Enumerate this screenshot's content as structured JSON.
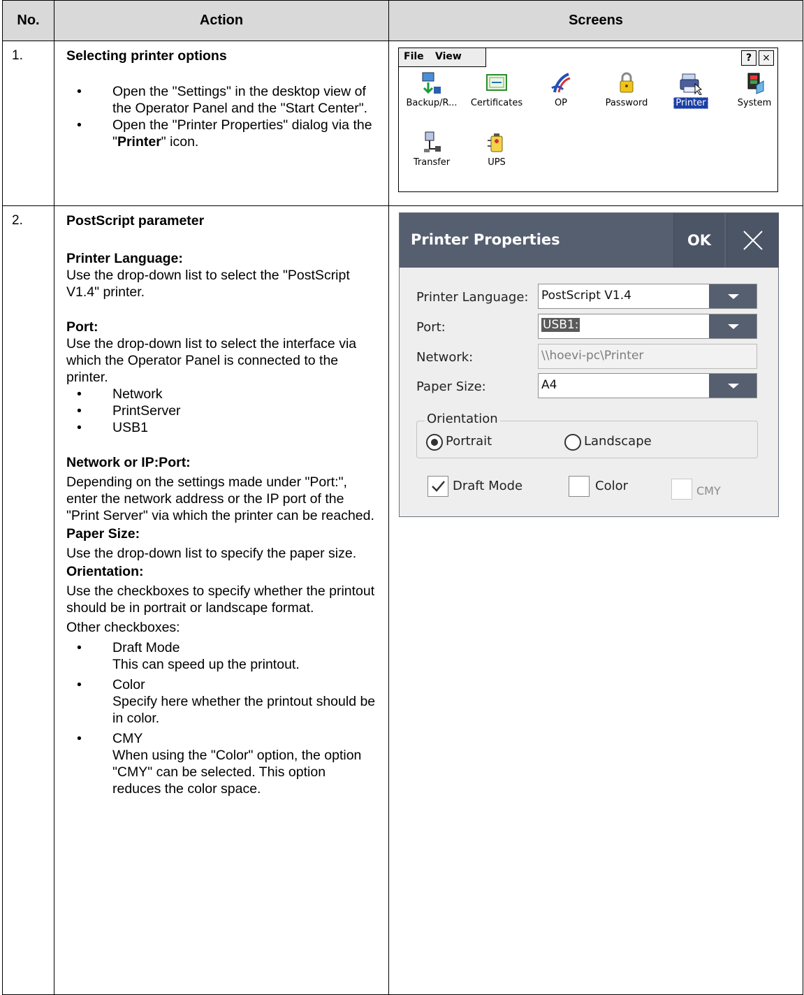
{
  "table": {
    "headers": {
      "no": "No.",
      "action": "Action",
      "screens": "Screens"
    }
  },
  "row1": {
    "number": "1.",
    "title": "Selecting printer options",
    "bullets": [
      "Open the \"Settings\" in the desktop view of the Operator Panel and the \"Start Center\".",
      {
        "pre": "Open the \"Printer Properties\" dialog via the \"",
        "bold": "Printer",
        "post": "\" icon."
      }
    ],
    "screen": {
      "menu": [
        "File",
        "View"
      ],
      "window_buttons": [
        "?",
        "×"
      ],
      "icons": [
        {
          "name": "backup-restore-icon",
          "label": "Backup/R..."
        },
        {
          "name": "certificates-icon",
          "label": "Certificates"
        },
        {
          "name": "op-icon",
          "label": "OP"
        },
        {
          "name": "password-icon",
          "label": "Password"
        },
        {
          "name": "printer-icon",
          "label": "Printer",
          "selected": true
        },
        {
          "name": "system-icon",
          "label": "System"
        },
        {
          "name": "transfer-icon",
          "label": "Transfer"
        },
        {
          "name": "ups-icon",
          "label": "UPS"
        }
      ]
    }
  },
  "row2": {
    "number": "2.",
    "title": "PostScript parameter",
    "printer_language_heading": "Printer Language:",
    "printer_language_text": "Use the drop-down list to select the \"PostScript V1.4\" printer.",
    "port_heading": "Port:",
    "port_text": "Use the drop-down list to select the interface via which the Operator Panel is connected to the printer.",
    "port_options": [
      "Network",
      "PrintServer",
      "USB1"
    ],
    "network_heading": "Network or IP:Port:",
    "network_text": "Depending on the settings made under \"Port:\", enter the network address or the IP port of the \"Print Server\" via which the printer can be reached.",
    "paper_heading": "Paper Size:",
    "paper_text": "Use the drop-down list to specify the paper size.",
    "orientation_heading": "Orientation:",
    "orientation_text": "Use the checkboxes to specify whether the printout should be in portrait or landscape format.",
    "other_heading": "Other checkboxes:",
    "other_items": [
      {
        "name": "Draft Mode",
        "desc": "This can speed up the printout."
      },
      {
        "name": "Color",
        "desc": "Specify here whether the printout should be in color."
      },
      {
        "name": "CMY",
        "desc": "When using the \"Color\" option, the option \"CMY\" can be selected. This option reduces the color space."
      }
    ],
    "dialog": {
      "title": "Printer Properties",
      "ok": "OK",
      "fields": {
        "printer_language": {
          "label": "Printer Language:",
          "value": "PostScript V1.4"
        },
        "port": {
          "label": "Port:",
          "value": "USB1:"
        },
        "network": {
          "label": "Network:",
          "value": "\\\\hoevi-pc\\Printer"
        },
        "paper_size": {
          "label": "Paper Size:",
          "value": "A4"
        }
      },
      "orientation": {
        "legend": "Orientation",
        "portrait": "Portrait",
        "landscape": "Landscape",
        "selected": "Portrait"
      },
      "checkboxes": [
        {
          "label": "Draft Mode",
          "checked": true,
          "enabled": true
        },
        {
          "label": "Color",
          "checked": false,
          "enabled": true
        },
        {
          "label": "CMY",
          "checked": false,
          "enabled": false
        }
      ]
    }
  }
}
